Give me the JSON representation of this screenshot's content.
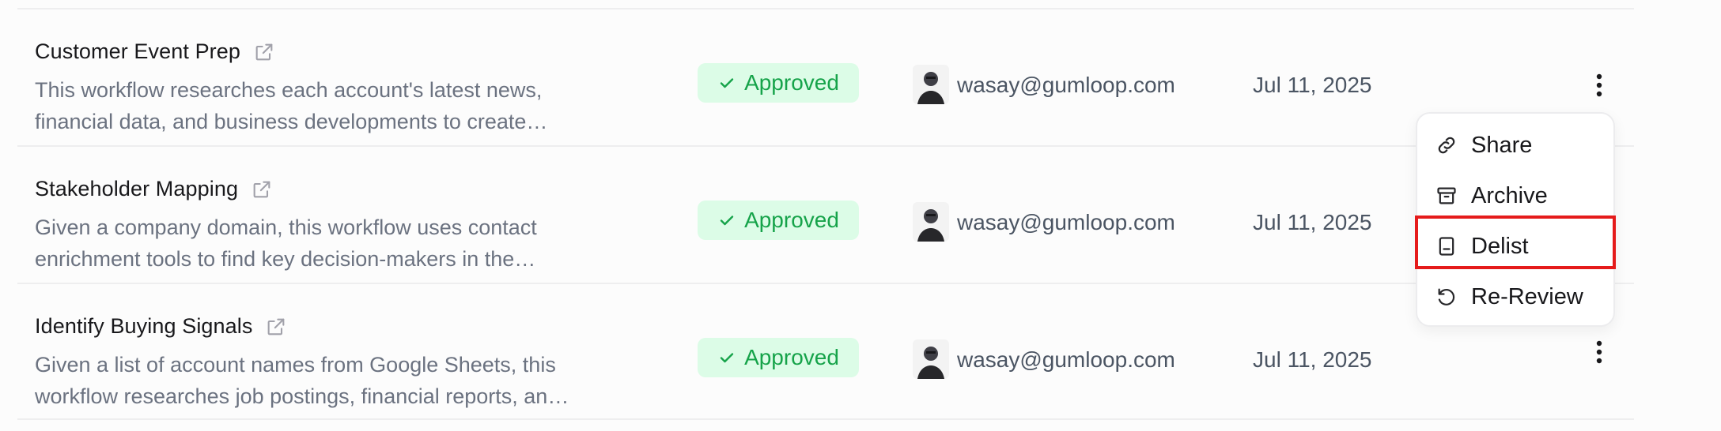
{
  "rows": [
    {
      "title": "Customer Event Prep",
      "description": "This workflow researches each account's latest news, financial data, and business developments to create…",
      "status": "Approved",
      "email": "wasay@gumloop.com",
      "date": "Jul 11, 2025"
    },
    {
      "title": "Stakeholder Mapping",
      "description": "Given a company domain, this workflow uses contact enrichment tools to find key decision-makers in the…",
      "status": "Approved",
      "email": "wasay@gumloop.com",
      "date": "Jul 11, 2025"
    },
    {
      "title": "Identify Buying Signals",
      "description": "Given a list of account names from Google Sheets, this workflow researches job postings, financial reports, an…",
      "status": "Approved",
      "email": "wasay@gumloop.com",
      "date": "Jul 11, 2025"
    }
  ],
  "menu": {
    "items": [
      {
        "label": "Share",
        "icon": "link-icon"
      },
      {
        "label": "Archive",
        "icon": "archive-icon"
      },
      {
        "label": "Delist",
        "icon": "delist-icon"
      },
      {
        "label": "Re-Review",
        "icon": "rotate-ccw-icon"
      }
    ],
    "highlighted": "Delist"
  },
  "colors": {
    "approved_bg": "#dcfce7",
    "approved_text": "#16a34a",
    "highlight_border": "#e51b1b",
    "muted_text": "#6b7280"
  }
}
